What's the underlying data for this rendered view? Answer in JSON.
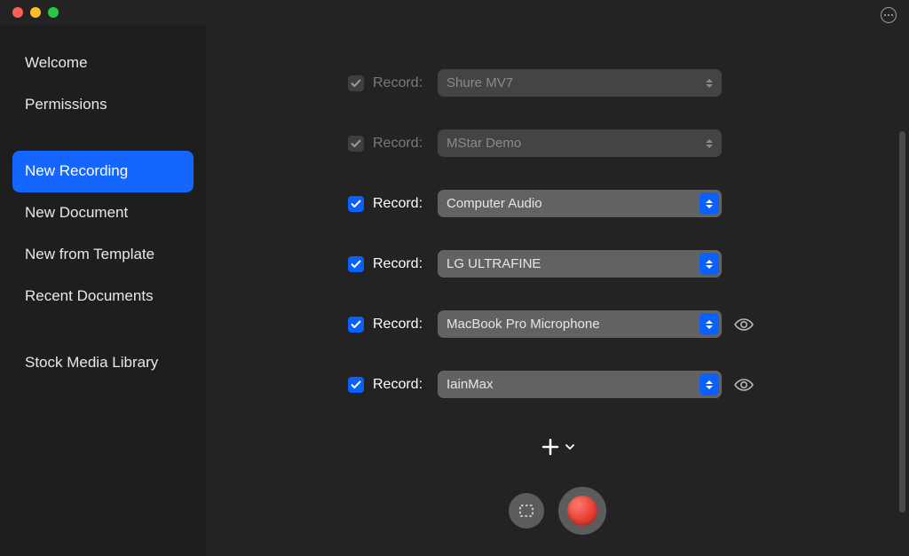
{
  "sidebar": {
    "groups": [
      {
        "items": [
          "Welcome",
          "Permissions"
        ]
      },
      {
        "items": [
          "New Recording",
          "New Document",
          "New from Template",
          "Recent Documents"
        ],
        "activeIndex": 0
      },
      {
        "items": [
          "Stock Media Library"
        ]
      }
    ]
  },
  "main": {
    "record_label": "Record:",
    "sources": [
      {
        "name": "Shure MV7",
        "enabled": true,
        "dimmed": true,
        "eye": false
      },
      {
        "name": "MStar Demo",
        "enabled": true,
        "dimmed": true,
        "eye": false
      },
      {
        "name": "Computer Audio",
        "enabled": true,
        "dimmed": false,
        "eye": false
      },
      {
        "name": "LG ULTRAFINE",
        "enabled": true,
        "dimmed": false,
        "eye": false
      },
      {
        "name": "MacBook Pro Microphone",
        "enabled": true,
        "dimmed": false,
        "eye": true
      },
      {
        "name": "IainMax",
        "enabled": true,
        "dimmed": false,
        "eye": true
      }
    ]
  }
}
